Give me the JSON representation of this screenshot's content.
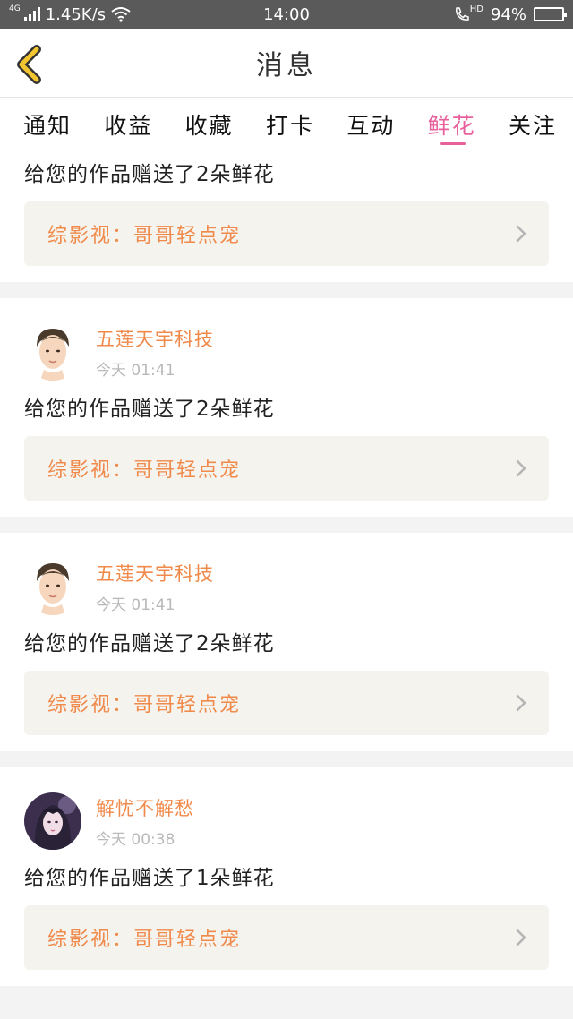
{
  "status_bar": {
    "network_type": "4G",
    "speed": "1.45K/s",
    "time": "14:00",
    "hd_label": "HD",
    "battery_percent": "94%",
    "battery_level": 0.94
  },
  "header": {
    "title": "消息",
    "back_icon": "chevron-left-icon",
    "accent_color": "#f2c531"
  },
  "tabs": [
    {
      "label": "通知",
      "active": false
    },
    {
      "label": "收益",
      "active": false
    },
    {
      "label": "收藏",
      "active": false
    },
    {
      "label": "打卡",
      "active": false
    },
    {
      "label": "互动",
      "active": false
    },
    {
      "label": "鲜花",
      "active": true
    },
    {
      "label": "关注",
      "active": false
    }
  ],
  "colors": {
    "active_tab": "#e8619c",
    "name": "#f08a4b",
    "time": "#b9b9b9",
    "work_box_bg": "#f4f3ee"
  },
  "messages": [
    {
      "text": "给您的作品赠送了2朵鲜花",
      "work": "综影视：哥哥轻点宠"
    },
    {
      "user_name": "五莲天宇科技",
      "time": "今天 01:41",
      "avatar": "male-avatar",
      "text": "给您的作品赠送了2朵鲜花",
      "work": "综影视：哥哥轻点宠"
    },
    {
      "user_name": "五莲天宇科技",
      "time": "今天 01:41",
      "avatar": "male-avatar",
      "text": "给您的作品赠送了2朵鲜花",
      "work": "综影视：哥哥轻点宠"
    },
    {
      "user_name": "解忧不解愁",
      "time": "今天 00:38",
      "avatar": "female-avatar",
      "text": "给您的作品赠送了1朵鲜花",
      "work": "综影视：哥哥轻点宠"
    }
  ]
}
